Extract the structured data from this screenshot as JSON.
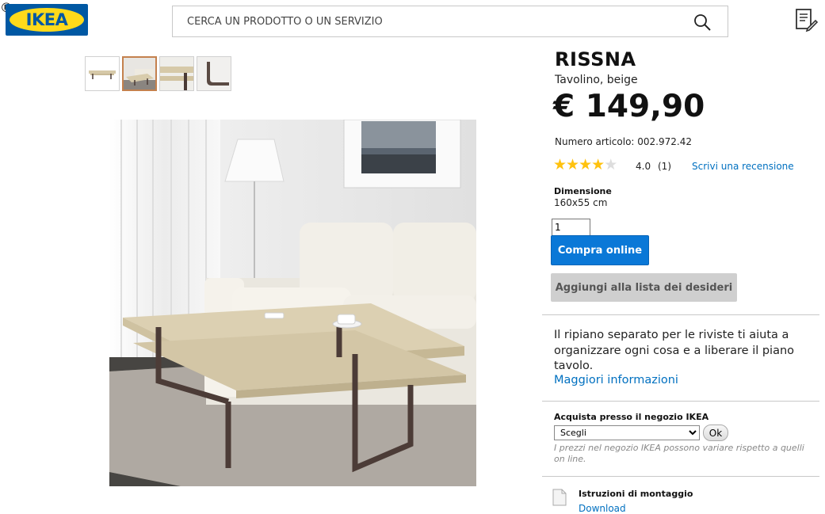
{
  "header": {
    "logo_text": "IKEA",
    "logo_reg": "®",
    "search_placeholder": "CERCA UN PRODOTTO O UN SERVIZIO",
    "search_icon": "search-icon",
    "list_icon": "shopping-list-icon"
  },
  "gallery": {
    "thumbnails": [
      "thumb-product-white",
      "thumb-room-scene",
      "thumb-detail-shelf",
      "thumb-detail-leg"
    ],
    "active_index": 1
  },
  "product": {
    "name": "RISSNA",
    "type": "Tavolino, beige",
    "price": "€ 149,90",
    "article_number": "Numero articolo: 002.972.42",
    "rating": {
      "stars": 4,
      "max": 5,
      "value": "4.0",
      "count": "(1)",
      "write_review": "Scrivi una recensione"
    },
    "dimension_label": "Dimensione",
    "dimension_value": "160x55 cm",
    "quantity": "1",
    "buy_label": "Compra online",
    "wishlist_label": "Aggiungi alla lista dei desideri",
    "description": "Il ripiano separato per le riviste ti aiuta a organizzare ogni cosa e a liberare il piano tavolo.",
    "more_info": "Maggiori informazioni"
  },
  "store": {
    "label": "Acquista presso il negozio IKEA",
    "select_value": "Scegli",
    "ok_label": "Ok",
    "note": "I prezzi nel negozio IKEA possono variare rispetto a quelli on line."
  },
  "assembly": {
    "label": "Istruzioni di montaggio",
    "download": "Download"
  },
  "colors": {
    "accent_blue": "#0a78d7",
    "link_blue": "#0070c0",
    "star_yellow": "#ffc20e",
    "brand_blue": "#0058a3",
    "brand_yellow": "#ffda1a"
  }
}
